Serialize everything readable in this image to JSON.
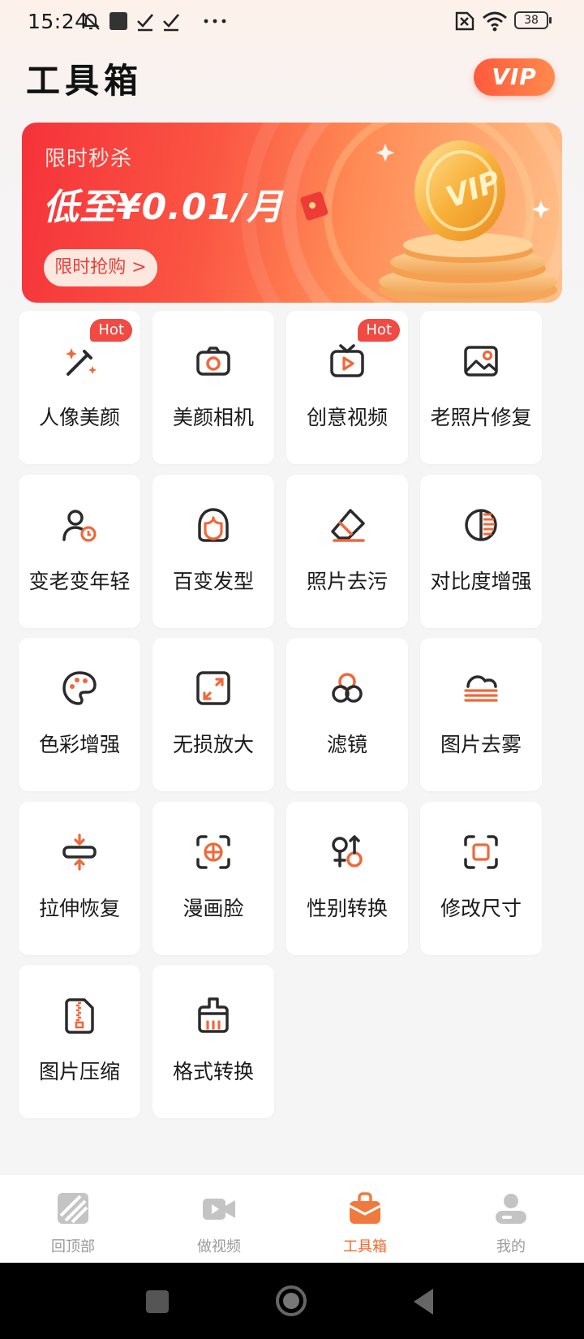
{
  "status_bar": {
    "time": "15:24",
    "icons": [
      "mute-icon",
      "square-icon",
      "check-icon",
      "check-icon",
      "more-dots-icon"
    ],
    "right_icons": [
      "sim-off-icon",
      "wifi-icon",
      "battery-icon"
    ],
    "battery": "38"
  },
  "header": {
    "title": "工具箱",
    "vip_label": "VIP"
  },
  "banner": {
    "subtitle": "限时秒杀",
    "headline": "低至¥0.01/月",
    "cta": "限时抢购 >"
  },
  "tools": [
    {
      "label": "人像美颜",
      "icon": "magic-wand-icon",
      "badge": "Hot"
    },
    {
      "label": "美颜相机",
      "icon": "camera-icon",
      "badge": ""
    },
    {
      "label": "创意视频",
      "icon": "tv-play-icon",
      "badge": "Hot"
    },
    {
      "label": "老照片修复",
      "icon": "image-icon",
      "badge": ""
    },
    {
      "label": "变老变年轻",
      "icon": "person-clock-icon",
      "badge": ""
    },
    {
      "label": "百变发型",
      "icon": "hair-icon",
      "badge": ""
    },
    {
      "label": "照片去污",
      "icon": "eraser-icon",
      "badge": ""
    },
    {
      "label": "对比度增强",
      "icon": "contrast-icon",
      "badge": ""
    },
    {
      "label": "色彩增强",
      "icon": "palette-icon",
      "badge": ""
    },
    {
      "label": "无损放大",
      "icon": "expand-icon",
      "badge": ""
    },
    {
      "label": "滤镜",
      "icon": "filter-circles-icon",
      "badge": ""
    },
    {
      "label": "图片去雾",
      "icon": "fog-icon",
      "badge": ""
    },
    {
      "label": "拉伸恢复",
      "icon": "stretch-icon",
      "badge": ""
    },
    {
      "label": "漫画脸",
      "icon": "face-scan-icon",
      "badge": ""
    },
    {
      "label": "性别转换",
      "icon": "gender-icon",
      "badge": ""
    },
    {
      "label": "修改尺寸",
      "icon": "resize-icon",
      "badge": ""
    },
    {
      "label": "图片压缩",
      "icon": "zip-file-icon",
      "badge": ""
    },
    {
      "label": "格式转换",
      "icon": "brush-icon",
      "badge": ""
    }
  ],
  "bottom_nav": [
    {
      "label": "回顶部",
      "icon": "back-to-top-icon",
      "active": false
    },
    {
      "label": "做视频",
      "icon": "video-camera-icon",
      "active": false
    },
    {
      "label": "工具箱",
      "icon": "toolbox-icon",
      "active": true
    },
    {
      "label": "我的",
      "icon": "profile-icon",
      "active": false
    }
  ],
  "colors": {
    "accent": "#f26a2e",
    "icon_accent": "#f0683a",
    "icon_dark": "#2b2b2b",
    "hot": "#f04a43"
  }
}
